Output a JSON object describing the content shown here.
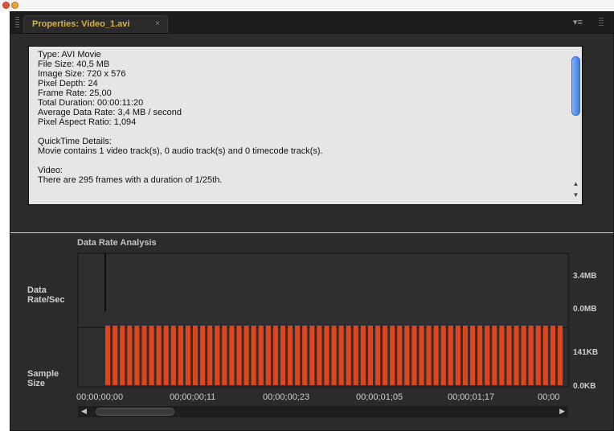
{
  "window": {
    "tab_label": "Properties: Video_1.avi",
    "tab_close": "×",
    "panel_menu": "▾≡"
  },
  "properties": {
    "lines": [
      "Type: AVI Movie",
      "File Size: 40,5 MB",
      "Image Size: 720 x 576",
      "Pixel Depth: 24",
      "Frame Rate: 25,00",
      "Total Duration: 00:00:11:20",
      "Average Data Rate: 3,4 MB / second",
      "Pixel Aspect Ratio: 1,094",
      "",
      "QuickTime Details:",
      "Movie contains 1 video track(s), 0 audio track(s) and 0 timecode track(s).",
      "",
      "Video:",
      "There are 295 frames with a duration of 1/25th."
    ],
    "scroll_up": "▲",
    "scroll_down": "▼"
  },
  "chart_data": {
    "type": "bar",
    "title": "Data Rate Analysis",
    "top_axis_label": "Data Rate/Sec",
    "bottom_axis_label": "Sample Size",
    "top_ticks": [
      "3.4MB",
      "0.0MB"
    ],
    "bottom_ticks": [
      "141KB",
      "0.0KB"
    ],
    "x_tick_labels": [
      "00;00;00;00",
      "00;00;00;11",
      "00;00;00;23",
      "00;00;01;05",
      "00;00;01;17",
      "00;00"
    ],
    "data_rate_line_mb": 3.4,
    "sample_size_bars_kb": [
      141,
      141,
      141,
      141,
      141,
      141,
      141,
      141,
      141,
      141,
      141,
      141,
      141,
      141,
      141,
      141,
      141,
      141,
      141,
      141,
      141,
      141,
      141,
      141,
      141,
      141,
      141,
      141,
      141,
      141,
      141,
      141,
      141,
      141,
      141,
      141,
      141,
      141,
      141,
      141,
      141,
      141,
      141,
      141,
      141,
      141,
      141,
      141,
      141,
      141,
      141,
      141,
      141,
      141,
      141,
      141,
      141,
      141,
      141,
      141,
      141,
      141,
      141
    ],
    "bar_color": "#e0441c",
    "grid": false
  },
  "scrollbar": {
    "left_arrow": "◀",
    "right_arrow": "▶"
  }
}
